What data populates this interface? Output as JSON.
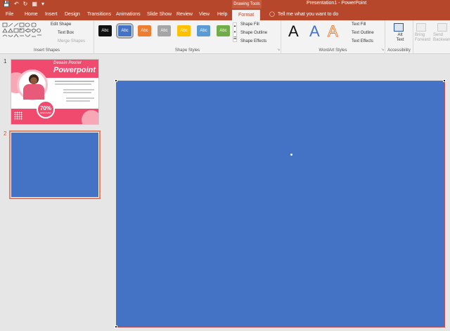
{
  "titlebar": {
    "window_title": "Presentation1 - PowerPoint",
    "context_tab": "Drawing Tools"
  },
  "tabs": [
    "File",
    "Home",
    "Insert",
    "Design",
    "Transitions",
    "Animations",
    "Slide Show",
    "Review",
    "View",
    "Help"
  ],
  "active_tab": "Format",
  "tell_me": "Tell me what you want to do",
  "ribbon": {
    "insert_shapes": {
      "edit_shape": "Edit Shape",
      "text_box": "Text Box",
      "merge_shapes": "Merge Shapes",
      "label": "Insert Shapes"
    },
    "shape_styles": {
      "swatch_text": "Abc",
      "fill": "Shape Fill",
      "outline": "Shape Outline",
      "effects": "Shape Effects",
      "label": "Shape Styles"
    },
    "wordart": {
      "letter": "A",
      "text_fill": "Text Fill",
      "text_outline": "Text Outline",
      "text_effects": "Text Effects",
      "label": "WordArt Styles"
    },
    "accessibility": {
      "alt_text": "Alt Text",
      "label": "Accessibility"
    },
    "arrange": {
      "bring_forward": "Bring Forward",
      "send_backward": "Send Backward"
    }
  },
  "slides": [
    {
      "number": "1",
      "title_line1": "Desain Poster",
      "title_line2": "Powerpoint",
      "badge": "70%",
      "badge_sub": "DISCOUNT"
    },
    {
      "number": "2"
    }
  ],
  "colors": {
    "accent": "#b7472a",
    "slide_fill": "#4472c4",
    "poster_pink": "#f04a6e"
  }
}
